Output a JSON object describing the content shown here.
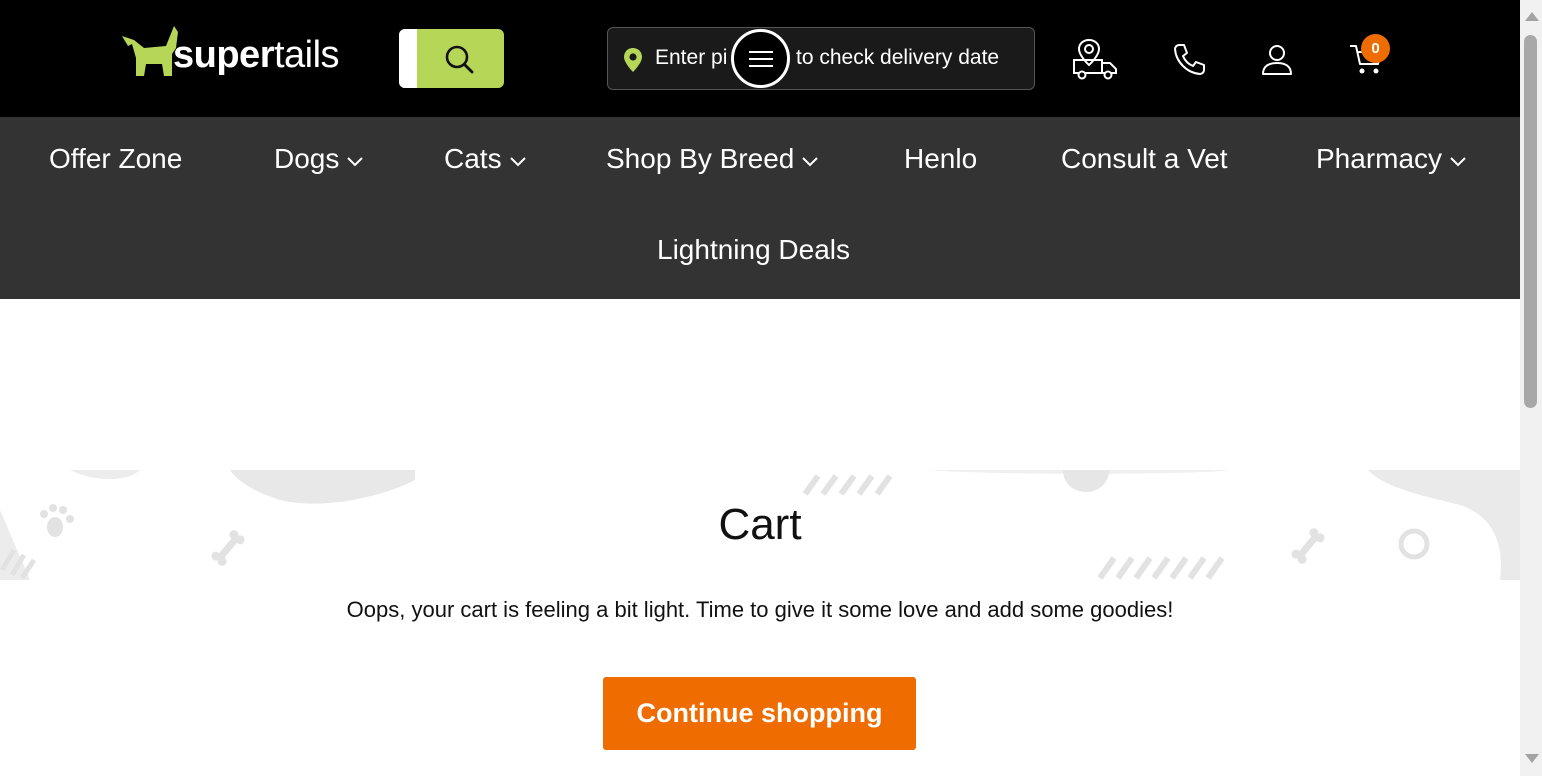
{
  "header": {
    "logo": {
      "part1": "super",
      "part2": "tails"
    },
    "pincode": {
      "text_before": "Enter pi",
      "text_after": "to check delivery date"
    },
    "cart_count": "0",
    "icons": [
      "search-icon",
      "location-pin-icon",
      "menu-icon",
      "delivery-truck-icon",
      "phone-icon",
      "user-icon",
      "cart-icon"
    ],
    "colors": {
      "accent_green": "#b5d657",
      "accent_orange": "#ef6c00"
    }
  },
  "nav": {
    "items": [
      {
        "label": "Offer Zone",
        "has_dropdown": false
      },
      {
        "label": "Dogs",
        "has_dropdown": true
      },
      {
        "label": "Cats",
        "has_dropdown": true
      },
      {
        "label": "Shop By Breed",
        "has_dropdown": true
      },
      {
        "label": "Henlo",
        "has_dropdown": false
      },
      {
        "label": "Consult a Vet",
        "has_dropdown": false
      },
      {
        "label": "Pharmacy",
        "has_dropdown": true
      },
      {
        "label": "Lightning Deals",
        "has_dropdown": false
      }
    ]
  },
  "cart": {
    "title": "Cart",
    "message": "Oops, your cart is feeling a bit light. Time to give it some love and add some goodies!",
    "continue_label": "Continue shopping"
  }
}
